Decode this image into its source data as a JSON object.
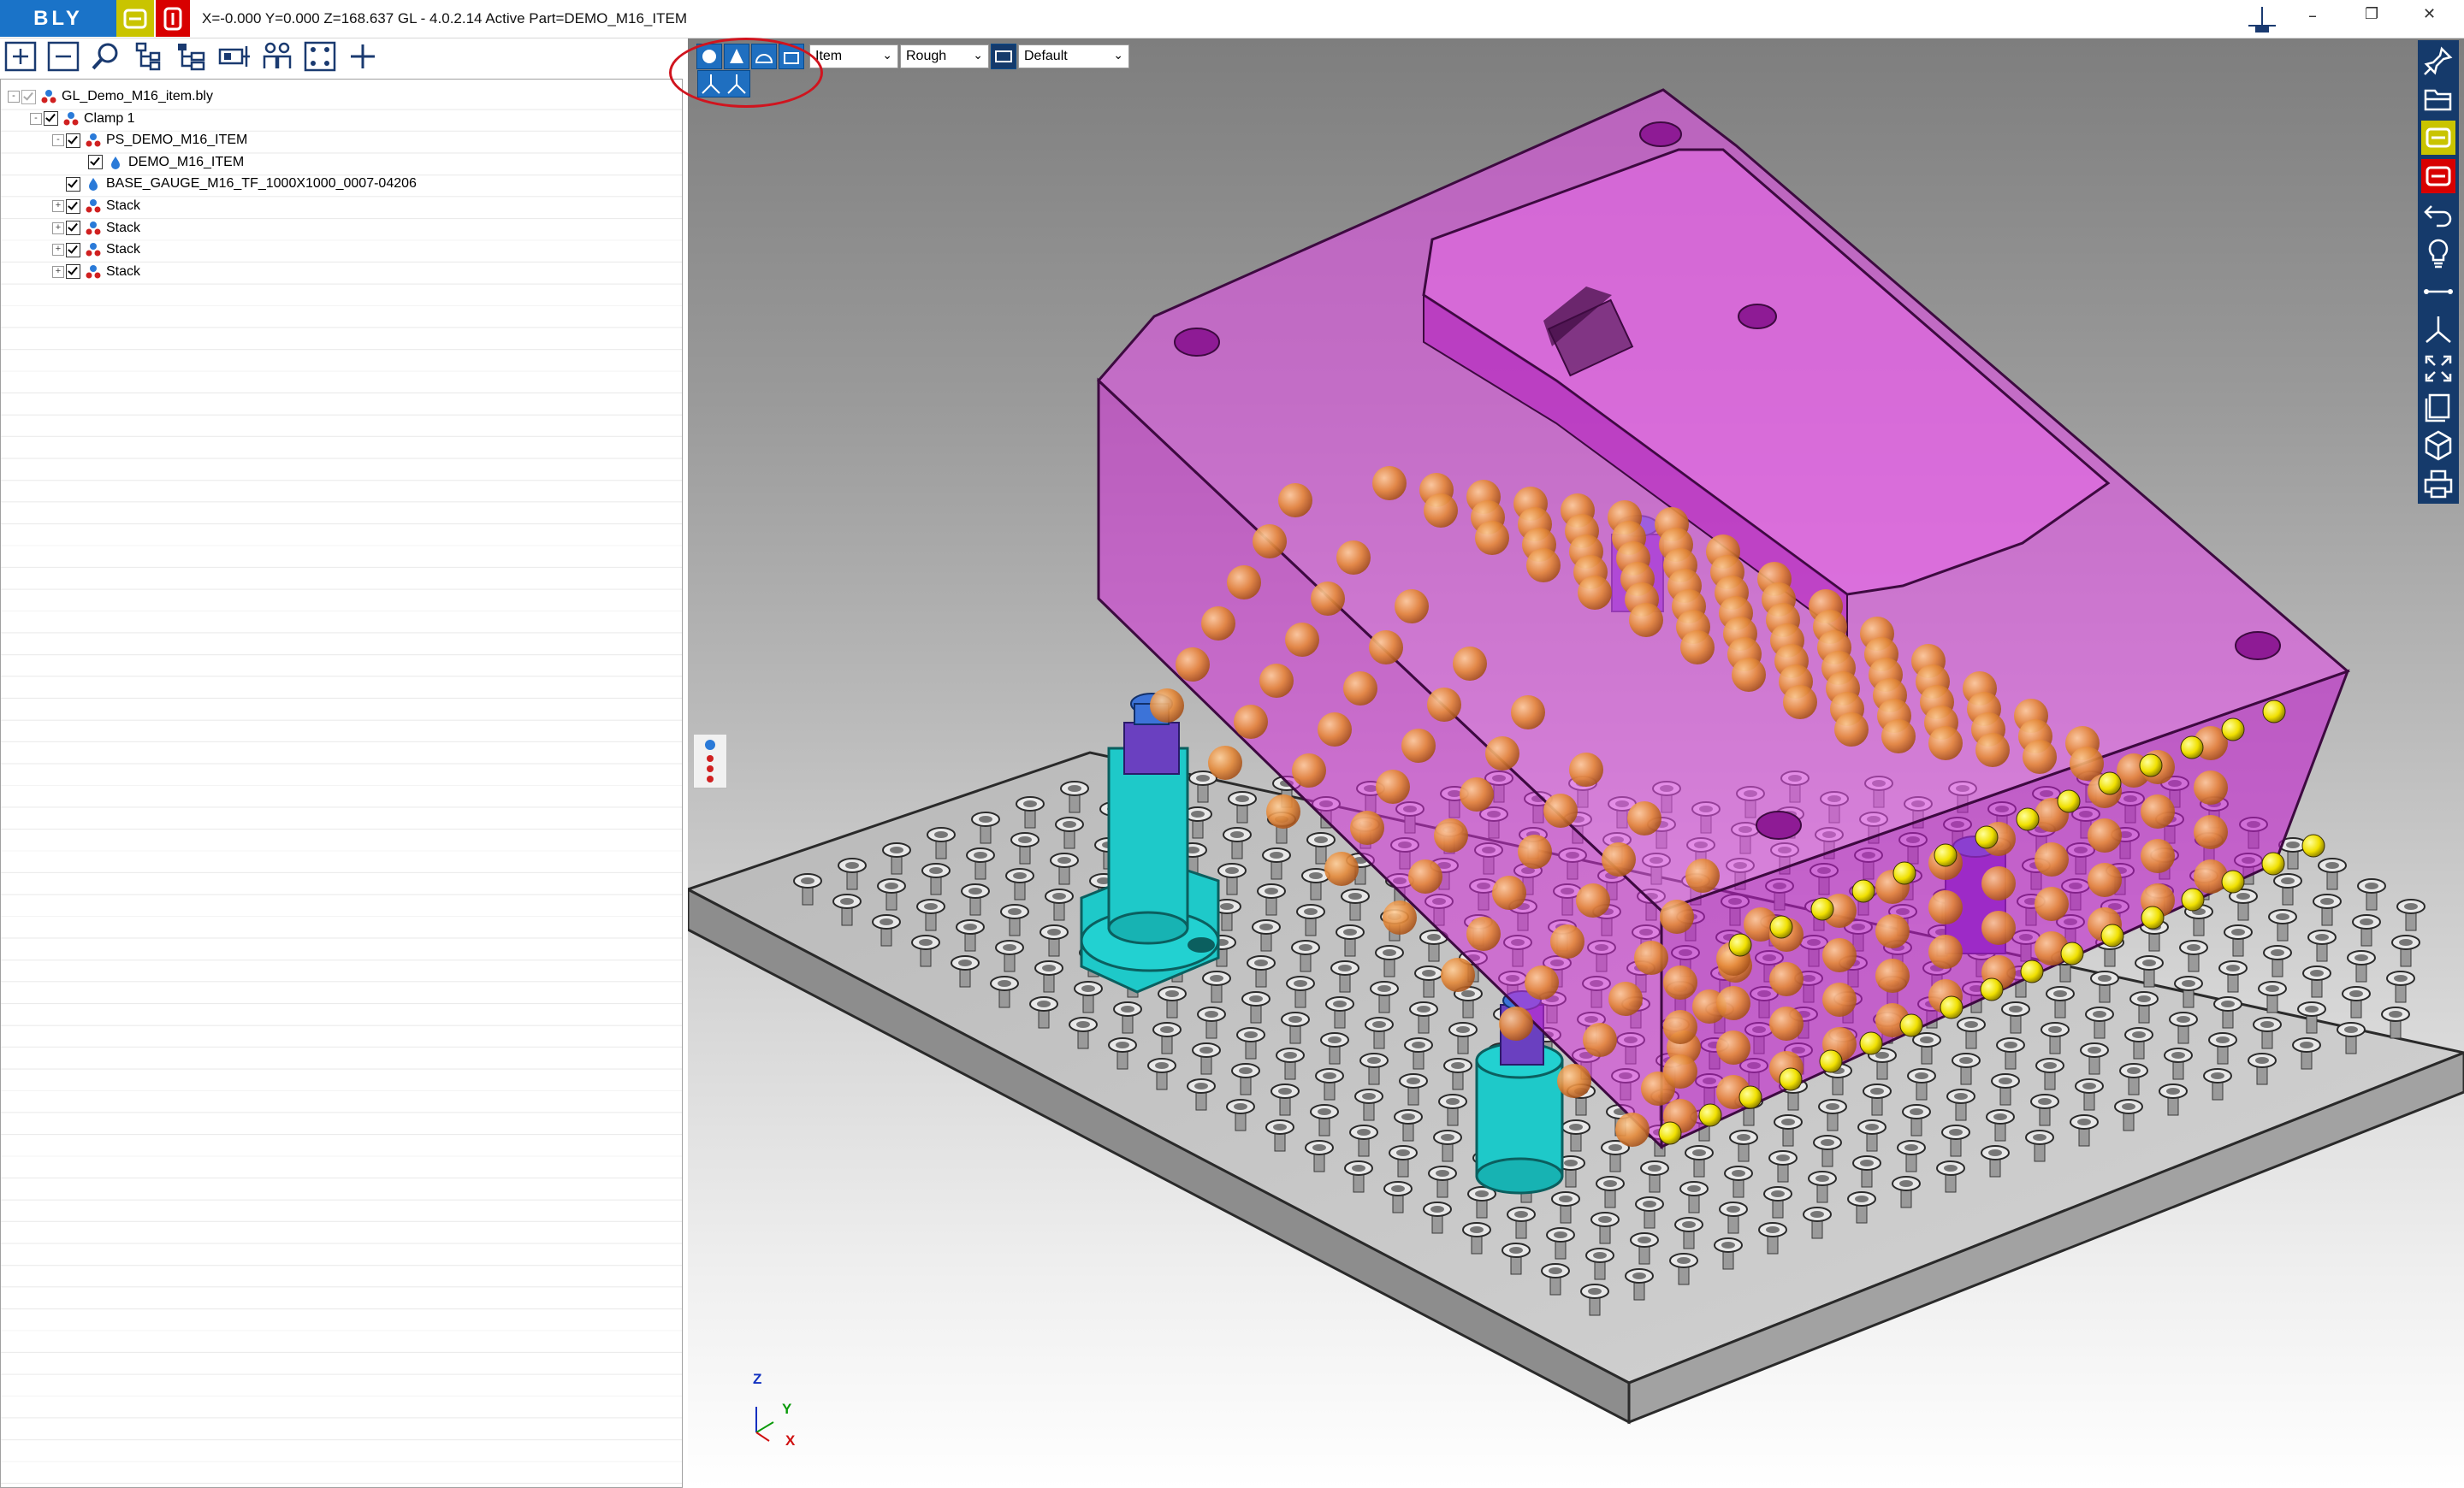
{
  "app": {
    "logo": "BLY",
    "logo_b": "B",
    "status": "X=-0.000 Y=0.000 Z=168.637   GL - 4.0.2.14 Active Part=DEMO_M16_ITEM"
  },
  "window": {
    "minimize": "–",
    "restore": "❐",
    "close": "✕"
  },
  "toolbar": {
    "icons": [
      "expand-all-icon",
      "collapse-all-icon",
      "search-icon",
      "tree-structure-icon",
      "tree-branch-icon",
      "component-icon",
      "people-icon",
      "fit-view-icon",
      "add-icon"
    ]
  },
  "tree": {
    "items": [
      {
        "label": "GL_Demo_M16_item.bly",
        "level": 0,
        "expander": "-",
        "checked": true,
        "grey": true,
        "icon": "assembly-icon"
      },
      {
        "label": "Clamp 1",
        "level": 1,
        "expander": "-",
        "checked": true,
        "icon": "assembly-icon"
      },
      {
        "label": "PS_DEMO_M16_ITEM",
        "level": 2,
        "expander": "-",
        "checked": true,
        "icon": "assembly-icon"
      },
      {
        "label": "DEMO_M16_ITEM",
        "level": 3,
        "expander": "",
        "checked": true,
        "icon": "part-icon"
      },
      {
        "label": "BASE_GAUGE_M16_TF_1000X1000_0007-04206",
        "level": 2,
        "expander": "",
        "checked": true,
        "icon": "part-icon"
      },
      {
        "label": "Stack",
        "level": 2,
        "expander": "+",
        "checked": true,
        "icon": "assembly-icon"
      },
      {
        "label": "Stack",
        "level": 2,
        "expander": "+",
        "checked": true,
        "icon": "assembly-icon"
      },
      {
        "label": "Stack",
        "level": 2,
        "expander": "+",
        "checked": true,
        "icon": "assembly-icon"
      },
      {
        "label": "Stack",
        "level": 2,
        "expander": "+",
        "checked": true,
        "icon": "assembly-icon"
      }
    ]
  },
  "viewport_toolbar": {
    "unit": "Item",
    "quality": "Rough",
    "style": "Default"
  },
  "axes": {
    "z": "Z",
    "y": "Y",
    "x": "X"
  },
  "right_toolbar": {
    "icons": [
      "pin-icon",
      "open-folder-icon",
      "bly-yellow-icon",
      "bly-red-icon",
      "undo-icon",
      "lightbulb-icon",
      "measure-icon",
      "axis-icon",
      "fit-all-icon",
      "layers-icon",
      "view-cube-icon",
      "print-icon"
    ]
  },
  "colors": {
    "brand": "#1a73c8",
    "part": "#d42bd8",
    "clamp": "#1ec9c9",
    "ball": "#e58a3a",
    "pin": "#f0e000",
    "toolbar_dark": "#153a6b",
    "highlight": "#d0141e"
  }
}
